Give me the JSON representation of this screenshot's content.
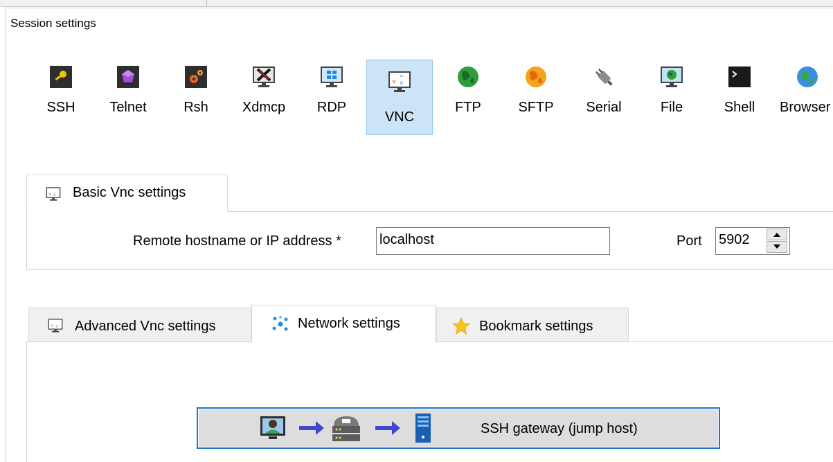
{
  "window": {
    "title": "Session settings"
  },
  "session_types": [
    {
      "label": "SSH",
      "icon": "key-icon",
      "selected": false
    },
    {
      "label": "Telnet",
      "icon": "purple-gem-icon",
      "selected": false
    },
    {
      "label": "Rsh",
      "icon": "gears-icon",
      "selected": false
    },
    {
      "label": "Xdmcp",
      "icon": "x-monitor-icon",
      "selected": false
    },
    {
      "label": "RDP",
      "icon": "windows-monitor-icon",
      "selected": false
    },
    {
      "label": "VNC",
      "icon": "vnc-monitor-icon",
      "selected": true
    },
    {
      "label": "FTP",
      "icon": "green-globe-icon",
      "selected": false
    },
    {
      "label": "SFTP",
      "icon": "orange-globe-icon",
      "selected": false
    },
    {
      "label": "Serial",
      "icon": "serial-plug-icon",
      "selected": false
    },
    {
      "label": "File",
      "icon": "file-monitor-icon",
      "selected": false
    },
    {
      "label": "Shell",
      "icon": "terminal-icon",
      "selected": false
    },
    {
      "label": "Browser",
      "icon": "browser-globe-icon",
      "selected": false
    }
  ],
  "basic_tab": {
    "label": "Basic Vnc settings",
    "hostname_label": "Remote hostname or IP address *",
    "hostname_value": "localhost",
    "port_label": "Port",
    "port_value": "5902"
  },
  "lower_tabs": [
    {
      "label": "Advanced Vnc settings",
      "icon": "vnc-monitor-icon",
      "active": false
    },
    {
      "label": "Network settings",
      "icon": "network-icon",
      "active": true
    },
    {
      "label": "Bookmark settings",
      "icon": "star-icon",
      "active": false
    }
  ],
  "network": {
    "gateway_button_label": "SSH gateway (jump host)"
  },
  "colors": {
    "selection_bg": "#cce4f7",
    "selection_border": "#99c9ef",
    "accent": "#1f75cc",
    "arrow": "#3f48cc"
  }
}
